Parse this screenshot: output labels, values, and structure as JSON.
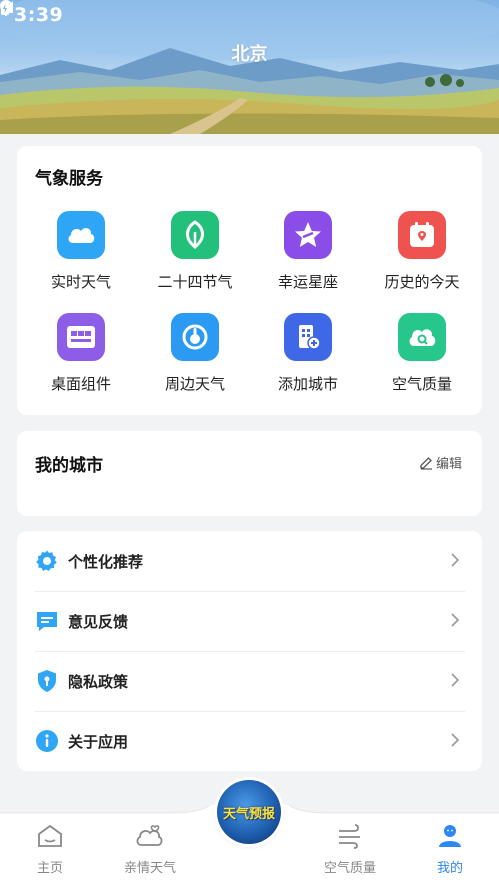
{
  "status_bar": {
    "time": "3:39"
  },
  "header": {
    "city": "北京"
  },
  "services": {
    "title": "气象服务",
    "items": [
      {
        "label": "实时天气",
        "icon": "cloud-icon",
        "color": "#2ea6f5"
      },
      {
        "label": "二十四节气",
        "icon": "leaf-icon",
        "color": "#22c07a"
      },
      {
        "label": "幸运星座",
        "icon": "star-icon",
        "color": "#8b4de8"
      },
      {
        "label": "历史的今天",
        "icon": "calendar-pin-icon",
        "color": "#ef5350"
      },
      {
        "label": "桌面组件",
        "icon": "widget-grid-icon",
        "color": "#8e5de8"
      },
      {
        "label": "周边天气",
        "icon": "location-icon",
        "color": "#2b9af3"
      },
      {
        "label": "添加城市",
        "icon": "building-add-icon",
        "color": "#3f68e6"
      },
      {
        "label": "空气质量",
        "icon": "cloud-search-icon",
        "color": "#27c68a"
      }
    ]
  },
  "my_city": {
    "title": "我的城市",
    "edit_label": "编辑"
  },
  "menu": {
    "items": [
      {
        "label": "个性化推荐",
        "icon": "gear-icon"
      },
      {
        "label": "意见反馈",
        "icon": "feedback-icon"
      },
      {
        "label": "隐私政策",
        "icon": "shield-icon"
      },
      {
        "label": "关于应用",
        "icon": "info-icon"
      }
    ]
  },
  "bottom_nav": {
    "items": [
      {
        "label": "主页",
        "icon": "home-icon",
        "active": false
      },
      {
        "label": "亲情天气",
        "icon": "family-weather-icon",
        "active": false
      },
      {
        "label": "空气质量",
        "icon": "wind-icon",
        "active": false
      },
      {
        "label": "我的",
        "icon": "user-icon",
        "active": true
      }
    ],
    "center_button_label": "天气预报"
  },
  "colors": {
    "accent": "#2f86f5",
    "icon_blue": "#2ea6f5"
  }
}
